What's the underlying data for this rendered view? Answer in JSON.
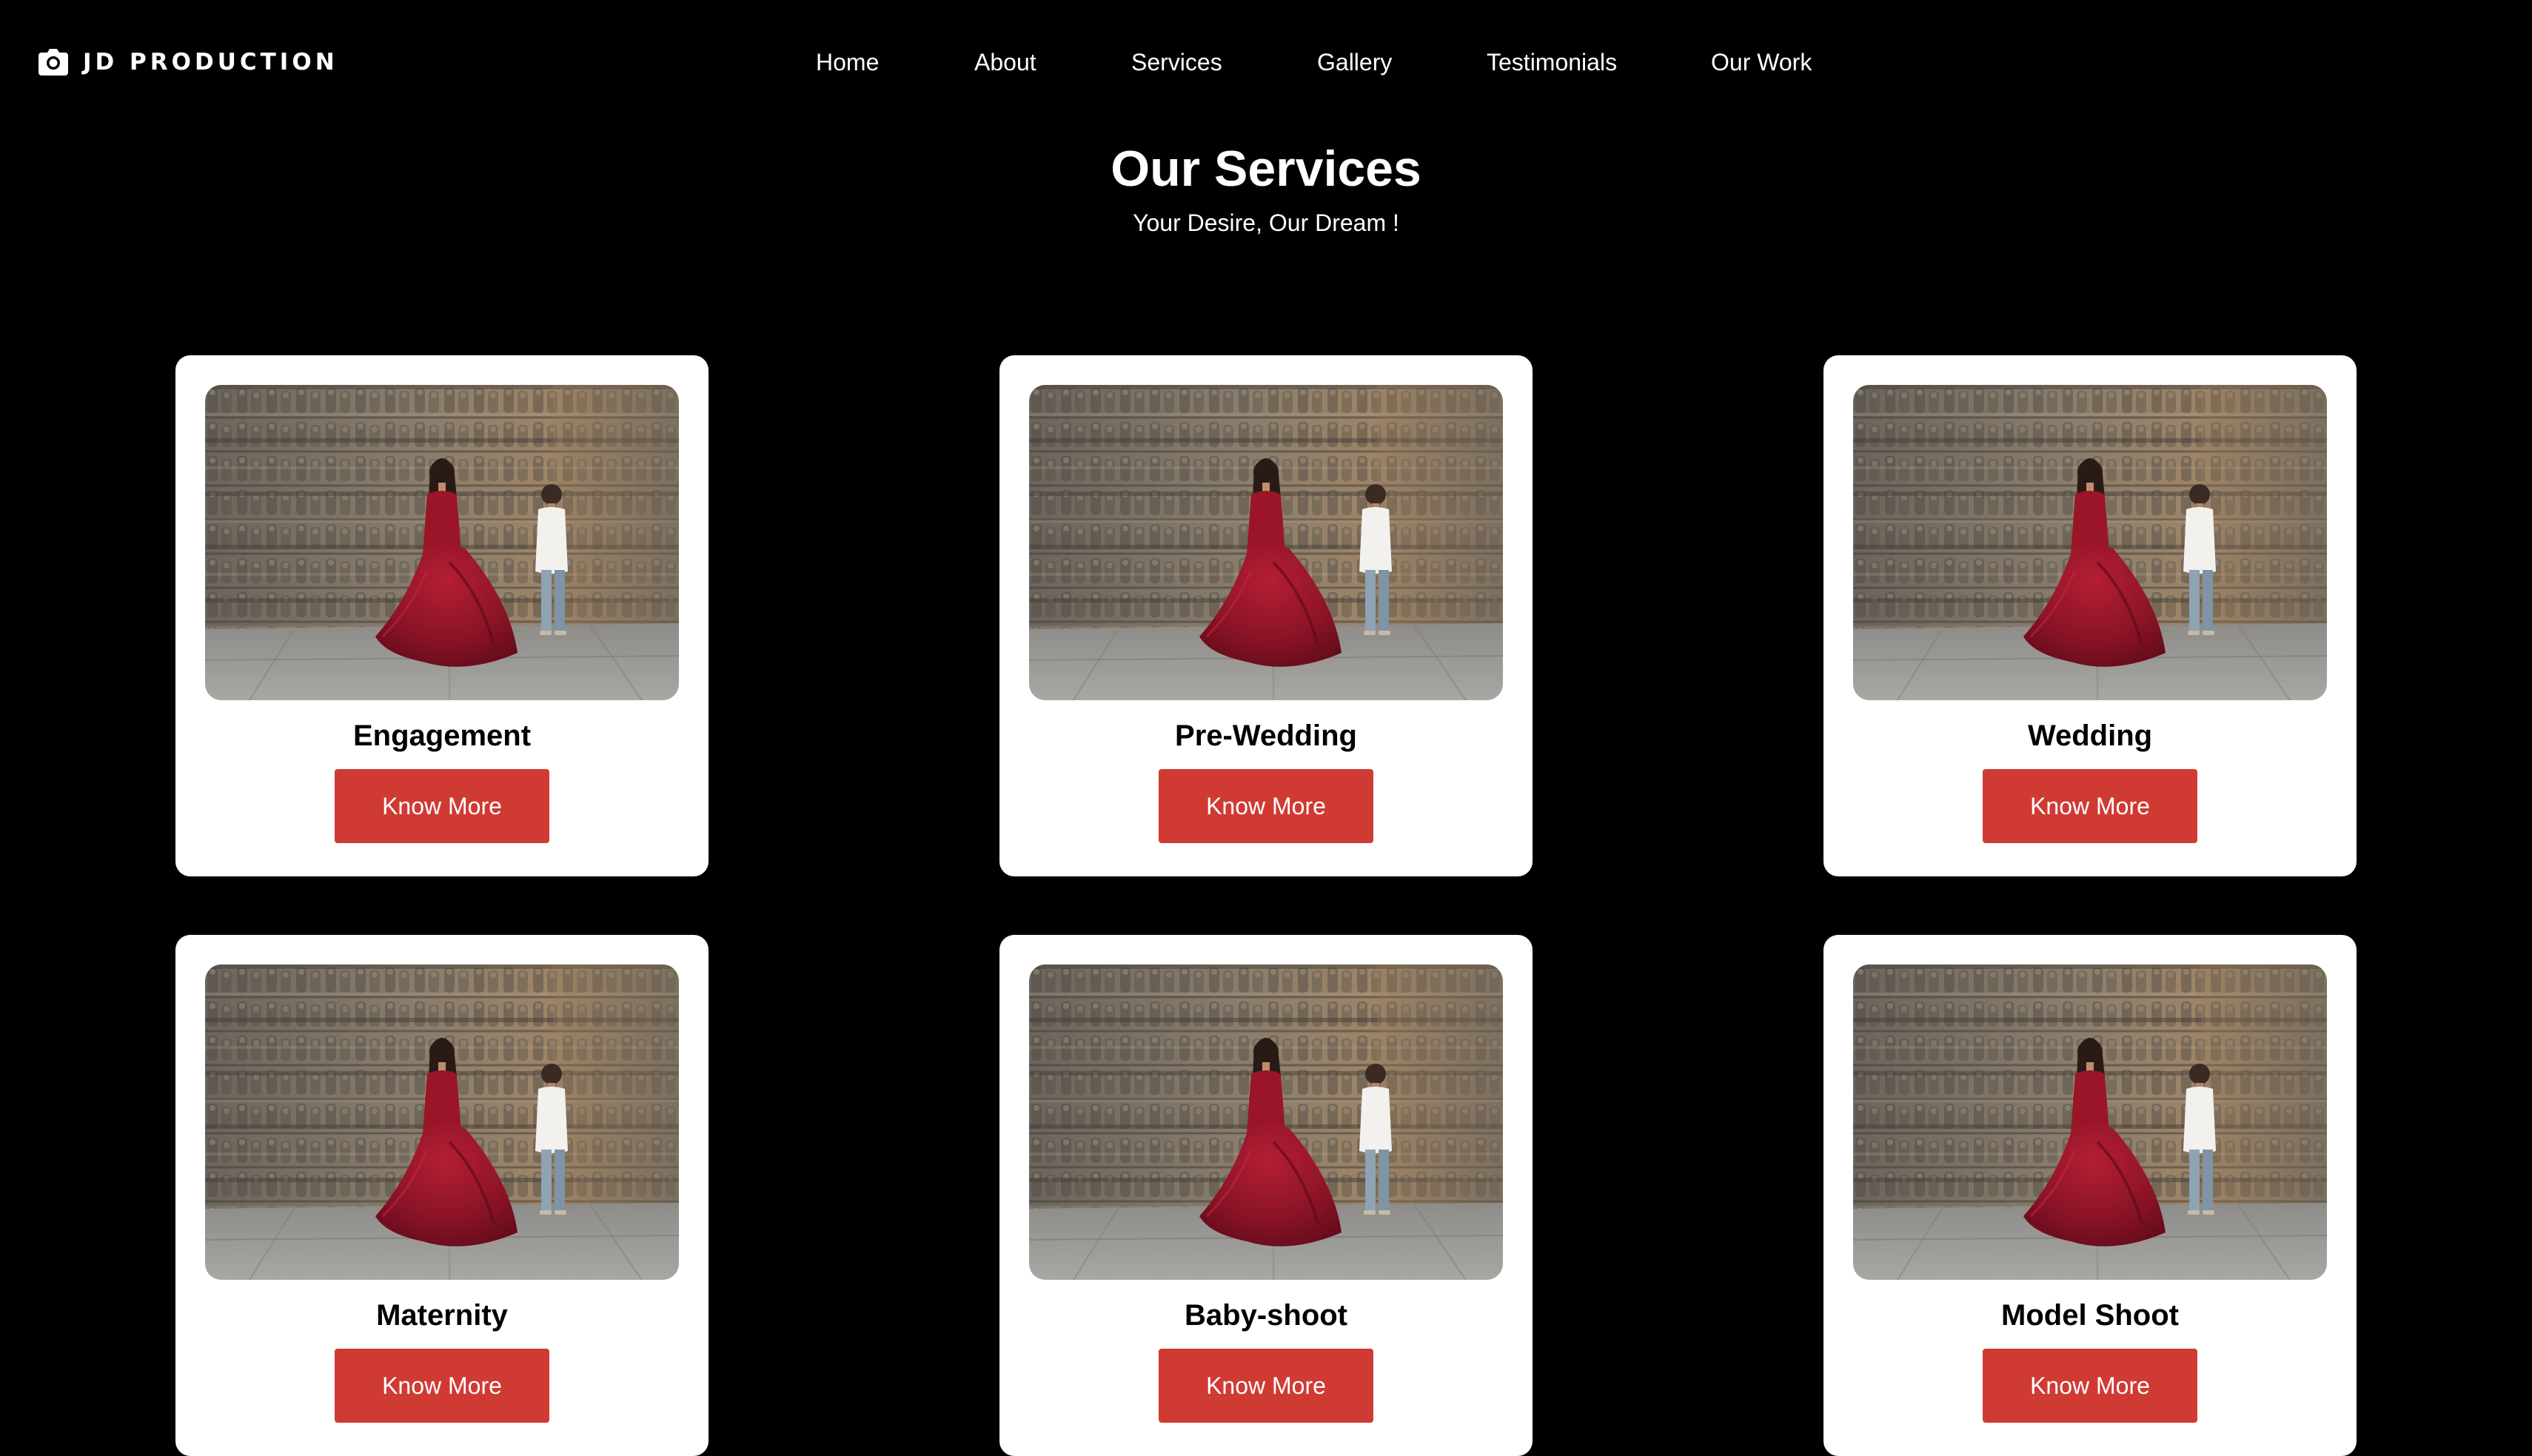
{
  "brand": {
    "name": "JD PRODUCTION",
    "icon": "camera-icon"
  },
  "nav": {
    "items": [
      {
        "label": "Home"
      },
      {
        "label": "About"
      },
      {
        "label": "Services"
      },
      {
        "label": "Gallery"
      },
      {
        "label": "Testimonials"
      },
      {
        "label": "Our Work"
      }
    ]
  },
  "services_section": {
    "title": "Our Services",
    "subtitle": "Your Desire, Our Dream !"
  },
  "cards": [
    {
      "title": "Engagement",
      "button": "Know More"
    },
    {
      "title": "Pre-Wedding",
      "button": "Know More"
    },
    {
      "title": "Wedding",
      "button": "Know More"
    },
    {
      "title": "Maternity",
      "button": "Know More"
    },
    {
      "title": "Baby-shoot",
      "button": "Know More"
    },
    {
      "title": "Model Shoot",
      "button": "Know More"
    }
  ],
  "colors": {
    "page_background": "#000000",
    "card_background": "#ffffff",
    "button_accent": "#cf3b33",
    "text_on_dark": "#ffffff",
    "text_on_card": "#000000"
  }
}
